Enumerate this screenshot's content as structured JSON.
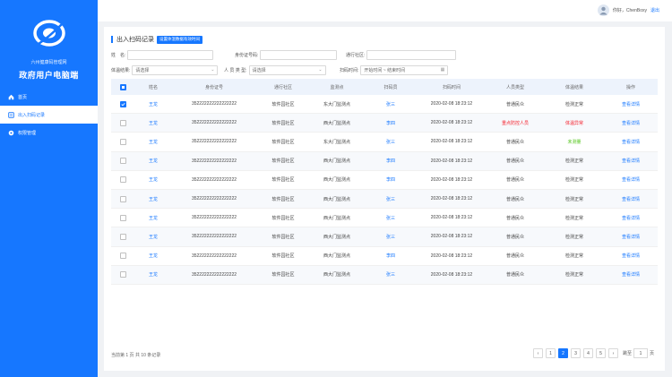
{
  "sidebar": {
    "org_name": "六州健康码管理网",
    "app_title": "政府用户电脑端",
    "items": [
      {
        "label": "首页"
      },
      {
        "label": "出入扫码记录"
      },
      {
        "label": "权限管理"
      }
    ]
  },
  "header": {
    "greeting": "你好，ChenBoxy",
    "logout_label": "退出"
  },
  "page": {
    "title": "出入扫码记录",
    "tag": "设置体温数据有效时间"
  },
  "filters": {
    "name_label": "姓　名:",
    "name_value": "",
    "id_label": "身份证号码:",
    "id_value": "",
    "community_label": "通行社区:",
    "community_value": "",
    "temp_label": "体温结果:",
    "temp_value": "请选择",
    "type_label": "人 员 类 型:",
    "type_value": "请选择",
    "time_label": "扫码时间:",
    "time_value": "开始时间 ~ 结束时间"
  },
  "table": {
    "headers": [
      "姓名",
      "身份证号",
      "通行社区",
      "监测点",
      "扫码员",
      "扫码时间",
      "人员类型",
      "体温结果",
      "操作"
    ],
    "rows": [
      {
        "checked": true,
        "name": "王龙",
        "id": "352222222222222222",
        "community": "软件园社区",
        "point": "东大门监测点",
        "scanner": "张三",
        "time": "2020-02-08 18:23:12",
        "type": "普通民众",
        "type_color": "normal",
        "temp": "检测正常",
        "temp_color": "normal",
        "action": "查看详情"
      },
      {
        "checked": false,
        "name": "王龙",
        "id": "352222222222222222",
        "community": "软件园社区",
        "point": "西大门监测点",
        "scanner": "李四",
        "time": "2020-02-08 18:23:12",
        "type": "重点防控人员",
        "type_color": "red",
        "temp": "体温异常",
        "temp_color": "red",
        "action": "查看详情"
      },
      {
        "checked": false,
        "name": "王龙",
        "id": "352222222222222222",
        "community": "软件园社区",
        "point": "东大门监测点",
        "scanner": "张三",
        "time": "2020-02-08 18:23:12",
        "type": "普通民众",
        "type_color": "normal",
        "temp": "未测量",
        "temp_color": "green",
        "action": "查看详情"
      },
      {
        "checked": false,
        "name": "王龙",
        "id": "352222222222222222",
        "community": "软件园社区",
        "point": "西大门监测点",
        "scanner": "李四",
        "time": "2020-02-08 18:23:12",
        "type": "普通民众",
        "type_color": "normal",
        "temp": "检测正常",
        "temp_color": "normal",
        "action": "查看详情"
      },
      {
        "checked": false,
        "name": "王龙",
        "id": "352222222222222222",
        "community": "软件园社区",
        "point": "西大门监测点",
        "scanner": "李四",
        "time": "2020-02-08 18:23:12",
        "type": "普通民众",
        "type_color": "normal",
        "temp": "检测正常",
        "temp_color": "normal",
        "action": "查看详情"
      },
      {
        "checked": false,
        "name": "王龙",
        "id": "352222222222222222",
        "community": "软件园社区",
        "point": "西大门监测点",
        "scanner": "张三",
        "time": "2020-02-08 18:23:12",
        "type": "普通民众",
        "type_color": "normal",
        "temp": "检测正常",
        "temp_color": "normal",
        "action": "查看详情"
      },
      {
        "checked": false,
        "name": "王龙",
        "id": "352222222222222222",
        "community": "软件园社区",
        "point": "西大门监测点",
        "scanner": "张三",
        "time": "2020-02-08 18:23:12",
        "type": "普通民众",
        "type_color": "normal",
        "temp": "检测正常",
        "temp_color": "normal",
        "action": "查看详情"
      },
      {
        "checked": false,
        "name": "王龙",
        "id": "352222222222222222",
        "community": "软件园社区",
        "point": "西大门监测点",
        "scanner": "张三",
        "time": "2020-02-08 18:23:12",
        "type": "普通民众",
        "type_color": "normal",
        "temp": "检测正常",
        "temp_color": "normal",
        "action": "查看详情"
      },
      {
        "checked": false,
        "name": "王龙",
        "id": "352222222222222222",
        "community": "软件园社区",
        "point": "西大门监测点",
        "scanner": "李四",
        "time": "2020-02-08 18:23:12",
        "type": "普通民众",
        "type_color": "normal",
        "temp": "检测正常",
        "temp_color": "normal",
        "action": "查看详情"
      },
      {
        "checked": false,
        "name": "王龙",
        "id": "352222222222222222",
        "community": "软件园社区",
        "point": "西大门监测点",
        "scanner": "张三",
        "time": "2020-02-08 18:23:12",
        "type": "普通民众",
        "type_color": "normal",
        "temp": "检测正常",
        "temp_color": "normal",
        "action": "查看详情"
      }
    ]
  },
  "footer": {
    "total_text": "当前第 1 页 共 10 条记录",
    "pages": [
      "1",
      "2",
      "3",
      "4",
      "5"
    ],
    "current_page": "2",
    "prev_label": "‹",
    "next_label": "›",
    "jump_prefix": "跳至",
    "jump_value": "1",
    "jump_suffix": "页"
  },
  "colors": {
    "accent": "#1677ff",
    "danger": "#f5222d",
    "success": "#52c41a"
  }
}
